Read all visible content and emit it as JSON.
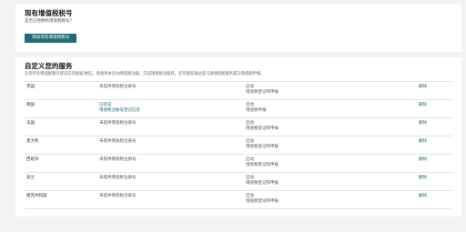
{
  "existing": {
    "title": "现有增值税税号",
    "question": "是否已经拥有增值税税号?",
    "add_button": "添加现有增值税税号"
  },
  "services": {
    "title": "自定义您的服务",
    "description": "在您所有增值税税号登记在的国家/地区。系统将本启动增值税注册。完成增值税注册后，您可能您通过亚马逊增值税服务提交增值税申报。",
    "rows": [
      {
        "country": "英国",
        "number": [
          "未提供增值税注册号"
        ],
        "status": [
          "启动",
          "增值税登记和申报"
        ],
        "action": "删除"
      },
      {
        "country": "德国",
        "number": [
          "已验证",
          "增值税注册号登记信息"
        ],
        "status": [
          "启动",
          "增值税申报"
        ],
        "action": "删除"
      },
      {
        "country": "法国",
        "number": [
          "未提供增值税注册号"
        ],
        "status": [
          "启动",
          "增值税登记和申报"
        ],
        "action": "删除"
      },
      {
        "country": "意大利",
        "number": [
          "未提供增值税注册号"
        ],
        "status": [
          "启动",
          "增值税登记和申报"
        ],
        "action": "删除"
      },
      {
        "country": "西班牙",
        "number": [
          "未提供增值税注册号"
        ],
        "status": [
          "启动",
          "增值税登记和申报"
        ],
        "action": "删除"
      },
      {
        "country": "波兰",
        "number": [
          "未提供增值税注册号"
        ],
        "status": [
          "启动",
          "增值税登记和申报"
        ],
        "action": "删除"
      },
      {
        "country": "捷克共和国",
        "number": [
          "未提供增值税注册号"
        ],
        "status": [
          "启动",
          "增值税登记和申报"
        ],
        "action": "删除"
      }
    ]
  },
  "colors": {
    "accent": "#1f6d73",
    "page_background": "#f3f3f3",
    "card_background": "#ffffff"
  }
}
